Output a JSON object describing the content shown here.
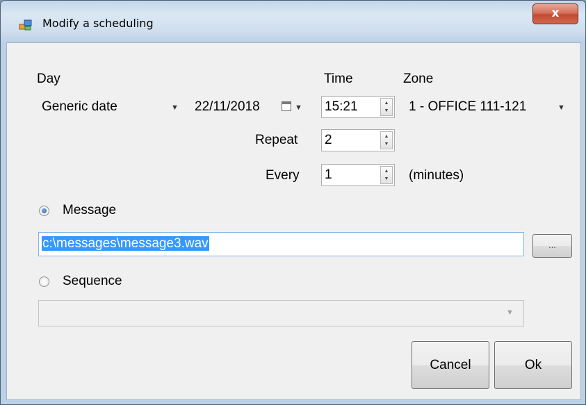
{
  "window": {
    "title": "Modify a scheduling",
    "close_label": "x"
  },
  "labels": {
    "day": "Day",
    "time": "Time",
    "zone": "Zone",
    "repeat": "Repeat",
    "every": "Every",
    "minutes": "(minutes)"
  },
  "day_type": {
    "selected": "Generic date"
  },
  "date": {
    "value": "22/11/2018"
  },
  "time": {
    "value": "15:21"
  },
  "zone": {
    "selected": "1 - OFFICE 111-121"
  },
  "repeat": {
    "value": "2"
  },
  "every": {
    "value": "1"
  },
  "message": {
    "label": "Message",
    "checked": true,
    "path": "c:\\messages\\message3.wav",
    "browse_label": "..."
  },
  "sequence": {
    "label": "Sequence",
    "checked": false,
    "selected": ""
  },
  "buttons": {
    "cancel": "Cancel",
    "ok": "Ok"
  },
  "colors": {
    "selection": "#3399ff",
    "close_button": "#c34a31",
    "dialog_bg": "#f0f0f0"
  }
}
